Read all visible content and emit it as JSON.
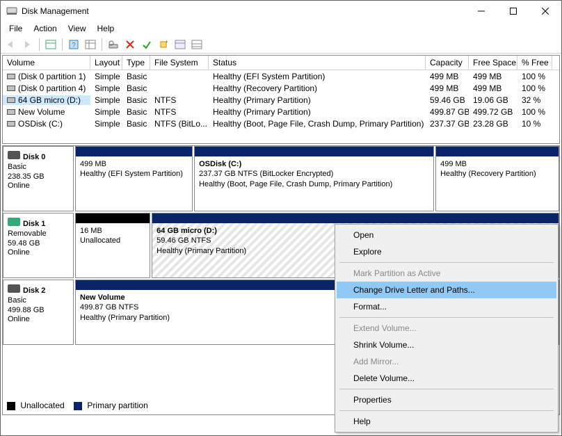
{
  "window": {
    "title": "Disk Management"
  },
  "menubar": [
    "File",
    "Action",
    "View",
    "Help"
  ],
  "volume_list": {
    "columns": [
      "Volume",
      "Layout",
      "Type",
      "File System",
      "Status",
      "Capacity",
      "Free Space",
      "% Free"
    ],
    "rows": [
      {
        "volume": "(Disk 0 partition 1)",
        "layout": "Simple",
        "type": "Basic",
        "fs": "",
        "status": "Healthy (EFI System Partition)",
        "capacity": "499 MB",
        "free": "499 MB",
        "pct": "100 %",
        "selected": false
      },
      {
        "volume": "(Disk 0 partition 4)",
        "layout": "Simple",
        "type": "Basic",
        "fs": "",
        "status": "Healthy (Recovery Partition)",
        "capacity": "499 MB",
        "free": "499 MB",
        "pct": "100 %",
        "selected": false
      },
      {
        "volume": "64 GB micro (D:)",
        "layout": "Simple",
        "type": "Basic",
        "fs": "NTFS",
        "status": "Healthy (Primary Partition)",
        "capacity": "59.46 GB",
        "free": "19.06 GB",
        "pct": "32 %",
        "selected": true
      },
      {
        "volume": "New Volume",
        "layout": "Simple",
        "type": "Basic",
        "fs": "NTFS",
        "status": "Healthy (Primary Partition)",
        "capacity": "499.87 GB",
        "free": "499.72 GB",
        "pct": "100 %",
        "selected": false
      },
      {
        "volume": "OSDisk (C:)",
        "layout": "Simple",
        "type": "Basic",
        "fs": "NTFS (BitLo...",
        "status": "Healthy (Boot, Page File, Crash Dump, Primary Partition)",
        "capacity": "237.37 GB",
        "free": "23.28 GB",
        "pct": "10 %",
        "selected": false
      }
    ]
  },
  "disks": [
    {
      "name": "Disk 0",
      "kind": "Basic",
      "size": "238.35 GB",
      "state": "Online",
      "removable": false,
      "partitions": [
        {
          "title": "",
          "line2": "499 MB",
          "line3": "Healthy (EFI System Partition)",
          "type": "primary",
          "flex": 19,
          "hatched": false
        },
        {
          "title": "OSDisk (C:)",
          "line2": "237.37 GB NTFS (BitLocker Encrypted)",
          "line3": "Healthy (Boot, Page File, Crash Dump, Primary Partition)",
          "type": "primary",
          "flex": 39,
          "hatched": false
        },
        {
          "title": "",
          "line2": "499 MB",
          "line3": "Healthy (Recovery Partition)",
          "type": "primary",
          "flex": 20,
          "hatched": false
        }
      ]
    },
    {
      "name": "Disk 1",
      "kind": "Removable",
      "size": "59.48 GB",
      "state": "Online",
      "removable": true,
      "partitions": [
        {
          "title": "",
          "line2": "16 MB",
          "line3": "Unallocated",
          "type": "unallocated",
          "flex": 12,
          "hatched": false
        },
        {
          "title": "64 GB micro  (D:)",
          "line2": "59.46 GB NTFS",
          "line3": "Healthy (Primary Partition)",
          "type": "primary",
          "flex": 66,
          "hatched": true
        }
      ]
    },
    {
      "name": "Disk 2",
      "kind": "Basic",
      "size": "499.88 GB",
      "state": "Online",
      "removable": false,
      "partitions": [
        {
          "title": "New Volume",
          "line2": "499.87 GB NTFS",
          "line3": "Healthy (Primary Partition)",
          "type": "primary",
          "flex": 78,
          "hatched": false
        }
      ]
    }
  ],
  "legend": {
    "unallocated": "Unallocated",
    "primary": "Primary partition"
  },
  "context_menu": [
    {
      "label": "Open",
      "enabled": true,
      "highlight": false
    },
    {
      "label": "Explore",
      "enabled": true,
      "highlight": false
    },
    {
      "sep": true
    },
    {
      "label": "Mark Partition as Active",
      "enabled": false,
      "highlight": false
    },
    {
      "label": "Change Drive Letter and Paths...",
      "enabled": true,
      "highlight": true
    },
    {
      "label": "Format...",
      "enabled": true,
      "highlight": false
    },
    {
      "sep": true
    },
    {
      "label": "Extend Volume...",
      "enabled": false,
      "highlight": false
    },
    {
      "label": "Shrink Volume...",
      "enabled": true,
      "highlight": false
    },
    {
      "label": "Add Mirror...",
      "enabled": false,
      "highlight": false
    },
    {
      "label": "Delete Volume...",
      "enabled": true,
      "highlight": false
    },
    {
      "sep": true
    },
    {
      "label": "Properties",
      "enabled": true,
      "highlight": false
    },
    {
      "sep": true
    },
    {
      "label": "Help",
      "enabled": true,
      "highlight": false
    }
  ]
}
